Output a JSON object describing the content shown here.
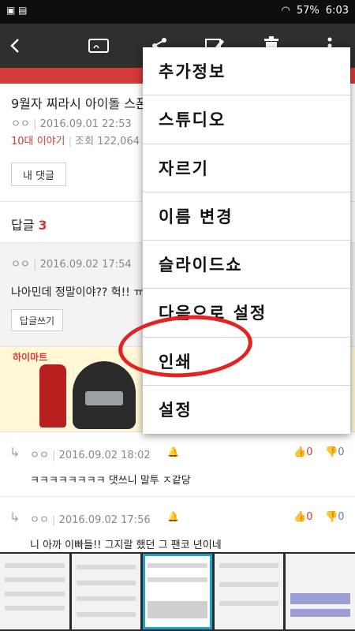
{
  "status_bar": {
    "battery": "57%",
    "time": "6:03"
  },
  "article": {
    "title": "9월자 찌라시 아이돌 스폰",
    "author": "ㅇㅇ",
    "date": "2016.09.01 22:53",
    "category": "10대 이야기",
    "views": "조회 122,064",
    "my_comment_label": "내 댓글"
  },
  "replies": {
    "label": "답글",
    "count": "3"
  },
  "reply_1": {
    "author": "ㅇㅇ",
    "date": "2016.09.02 17:54",
    "text": "나아민데 정말이야?? 헉!! ㅠ",
    "reply_button": "답글쓰기"
  },
  "ad": {
    "brand": "하이마트"
  },
  "reply_2": {
    "author": "ㅇㅇ",
    "date": "2016.09.02 18:02",
    "text": "ㅋㅋㅋㅋㅋㅋㅋㅋ 댓쓰니 말투 ㅈ같당",
    "likes": "0",
    "dislikes": "0"
  },
  "reply_3": {
    "author": "ㅇㅇ",
    "date": "2016.09.02 17:56",
    "text": "니 아까 이빠들!! 그지랄 했던 그 팬코 년이네",
    "likes": "0",
    "dislikes": "0"
  },
  "menu": {
    "items": [
      {
        "label": "추가정보"
      },
      {
        "label": "스튜디오"
      },
      {
        "label": "자르기"
      },
      {
        "label": "이름 변경"
      },
      {
        "label": "슬라이드쇼"
      },
      {
        "label": "다음으로 설정"
      },
      {
        "label": "인쇄"
      },
      {
        "label": "설정"
      }
    ]
  },
  "colors": {
    "accent": "#d43a3a",
    "highlight_circle": "#e52222",
    "thumb_selected": "#1aa3c7"
  }
}
